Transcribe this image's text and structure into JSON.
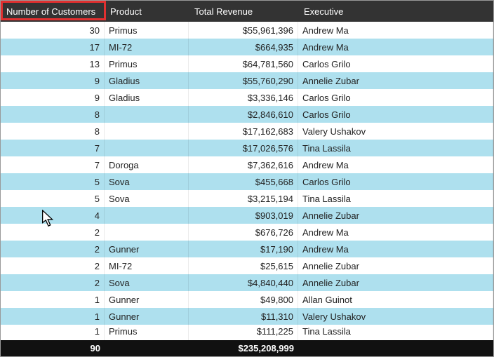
{
  "columns": {
    "num": "Number of Customers",
    "prod": "Product",
    "rev": "Total Revenue",
    "exec": "Executive"
  },
  "rows": [
    {
      "num": "30",
      "prod": "Primus",
      "rev": "$55,961,396",
      "exec": "Andrew Ma"
    },
    {
      "num": "17",
      "prod": "MI-72",
      "rev": "$664,935",
      "exec": "Andrew Ma"
    },
    {
      "num": "13",
      "prod": "Primus",
      "rev": "$64,781,560",
      "exec": "Carlos Grilo"
    },
    {
      "num": "9",
      "prod": "Gladius",
      "rev": "$55,760,290",
      "exec": "Annelie Zubar"
    },
    {
      "num": "9",
      "prod": "Gladius",
      "rev": "$3,336,146",
      "exec": "Carlos Grilo"
    },
    {
      "num": "8",
      "prod": "",
      "rev": "$2,846,610",
      "exec": "Carlos Grilo"
    },
    {
      "num": "8",
      "prod": "",
      "rev": "$17,162,683",
      "exec": "Valery Ushakov"
    },
    {
      "num": "7",
      "prod": "",
      "rev": "$17,026,576",
      "exec": "Tina Lassila"
    },
    {
      "num": "7",
      "prod": "Doroga",
      "rev": "$7,362,616",
      "exec": "Andrew Ma"
    },
    {
      "num": "5",
      "prod": "Sova",
      "rev": "$455,668",
      "exec": "Carlos Grilo"
    },
    {
      "num": "5",
      "prod": "Sova",
      "rev": "$3,215,194",
      "exec": "Tina Lassila"
    },
    {
      "num": "4",
      "prod": "",
      "rev": "$903,019",
      "exec": "Annelie Zubar"
    },
    {
      "num": "2",
      "prod": "",
      "rev": "$676,726",
      "exec": "Andrew Ma"
    },
    {
      "num": "2",
      "prod": "Gunner",
      "rev": "$17,190",
      "exec": "Andrew Ma"
    },
    {
      "num": "2",
      "prod": "MI-72",
      "rev": "$25,615",
      "exec": "Annelie Zubar"
    },
    {
      "num": "2",
      "prod": "Sova",
      "rev": "$4,840,440",
      "exec": "Annelie Zubar"
    },
    {
      "num": "1",
      "prod": "Gunner",
      "rev": "$49,800",
      "exec": "Allan Guinot"
    },
    {
      "num": "1",
      "prod": "Gunner",
      "rev": "$11,310",
      "exec": "Valery Ushakov"
    }
  ],
  "partial_row": {
    "num": "1",
    "prod": "Primus",
    "rev": "$111,225",
    "exec": "Tina Lassila"
  },
  "footer": {
    "num": "90",
    "rev": "$235,208,999"
  },
  "chart_data": {
    "type": "table",
    "title": "",
    "columns": [
      "Number of Customers",
      "Product",
      "Total Revenue",
      "Executive"
    ],
    "rows": [
      [
        30,
        "Primus",
        55961396,
        "Andrew Ma"
      ],
      [
        17,
        "MI-72",
        664935,
        "Andrew Ma"
      ],
      [
        13,
        "Primus",
        64781560,
        "Carlos Grilo"
      ],
      [
        9,
        "Gladius",
        55760290,
        "Annelie Zubar"
      ],
      [
        9,
        "Gladius",
        3336146,
        "Carlos Grilo"
      ],
      [
        8,
        null,
        2846610,
        "Carlos Grilo"
      ],
      [
        8,
        null,
        17162683,
        "Valery Ushakov"
      ],
      [
        7,
        null,
        17026576,
        "Tina Lassila"
      ],
      [
        7,
        "Doroga",
        7362616,
        "Andrew Ma"
      ],
      [
        5,
        "Sova",
        455668,
        "Carlos Grilo"
      ],
      [
        5,
        "Sova",
        3215194,
        "Tina Lassila"
      ],
      [
        4,
        null,
        903019,
        "Annelie Zubar"
      ],
      [
        2,
        null,
        676726,
        "Andrew Ma"
      ],
      [
        2,
        "Gunner",
        17190,
        "Andrew Ma"
      ],
      [
        2,
        "MI-72",
        25615,
        "Annelie Zubar"
      ],
      [
        2,
        "Sova",
        4840440,
        "Annelie Zubar"
      ],
      [
        1,
        "Gunner",
        49800,
        "Allan Guinot"
      ],
      [
        1,
        "Gunner",
        11310,
        "Valery Ushakov"
      ],
      [
        1,
        "Primus",
        111225,
        "Tina Lassila"
      ]
    ],
    "totals": {
      "Number of Customers": 90,
      "Total Revenue": 235208999
    },
    "highlighted_column": "Number of Customers"
  }
}
